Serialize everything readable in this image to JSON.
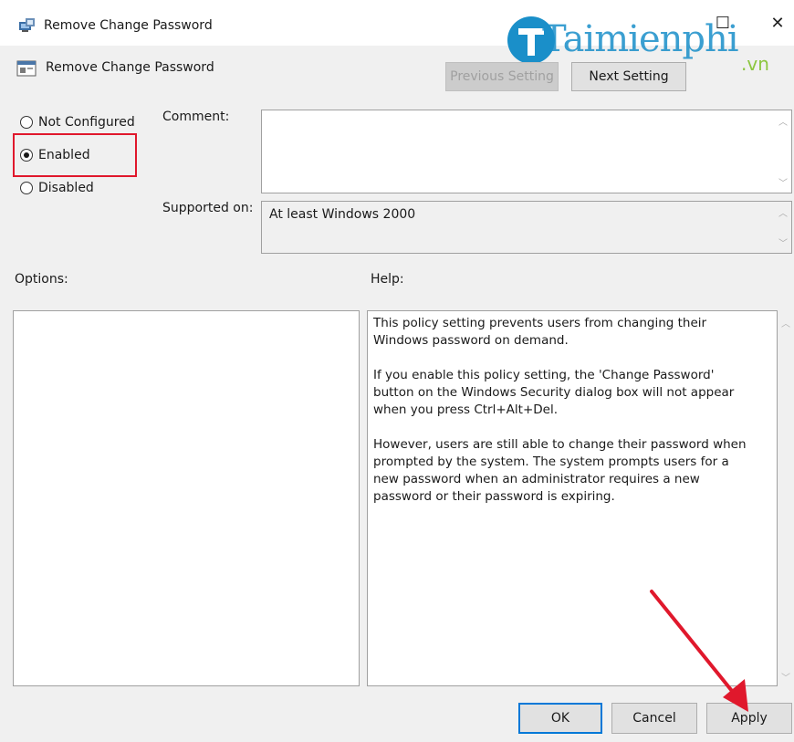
{
  "window": {
    "title": "Remove Change Password",
    "maximize_glyph": "☐",
    "close_glyph": "✕"
  },
  "header": {
    "setting_name": "Remove Change Password",
    "previous_label": "Previous Setting",
    "next_label": "Next Setting"
  },
  "watermark": {
    "text": "Taimienphi",
    "suffix": ".vn"
  },
  "state": {
    "options": [
      {
        "label": "Not Configured",
        "checked": false
      },
      {
        "label": "Enabled",
        "checked": true
      },
      {
        "label": "Disabled",
        "checked": false
      }
    ]
  },
  "comment": {
    "label": "Comment:",
    "value": ""
  },
  "supported": {
    "label": "Supported on:",
    "value": "At least Windows 2000"
  },
  "options_pane": {
    "label": "Options:"
  },
  "help_pane": {
    "label": "Help:",
    "paragraphs": [
      "This policy setting prevents users from changing their Windows password on demand.",
      "If you enable this policy setting,  the 'Change Password' button on the Windows Security dialog box will not appear when you press Ctrl+Alt+Del.",
      "However, users are still able to change their password when prompted by the system. The system prompts users for a new password when an administrator requires a new password or their password is expiring."
    ]
  },
  "footer": {
    "ok_label": "OK",
    "cancel_label": "Cancel",
    "apply_label": "Apply"
  },
  "colors": {
    "highlight": "#e0182c",
    "arrow": "#e0182c",
    "watermark": "#1a8fc9",
    "watermark_suffix": "#8cc63f",
    "default_button_border": "#0078d7"
  },
  "icons": {
    "app": "group-policy-icon",
    "setting": "policy-setting-icon",
    "scroll_up": "scroll-up-icon",
    "scroll_down": "scroll-down-icon"
  }
}
